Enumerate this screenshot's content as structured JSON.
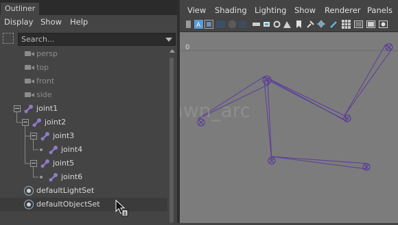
{
  "outliner": {
    "tab_label": "Outliner",
    "menu": [
      "Display",
      "Show",
      "Help"
    ],
    "search": {
      "placeholder": "Search..."
    },
    "items": [
      {
        "label": "persp",
        "type": "camera"
      },
      {
        "label": "top",
        "type": "camera"
      },
      {
        "label": "front",
        "type": "camera"
      },
      {
        "label": "side",
        "type": "camera"
      },
      {
        "label": "joint1",
        "type": "joint"
      },
      {
        "label": "joint2",
        "type": "joint"
      },
      {
        "label": "joint3",
        "type": "joint"
      },
      {
        "label": "joint4",
        "type": "joint"
      },
      {
        "label": "joint5",
        "type": "joint"
      },
      {
        "label": "joint6",
        "type": "joint"
      },
      {
        "label": "defaultLightSet",
        "type": "set"
      },
      {
        "label": "defaultObjectSet",
        "type": "set",
        "selected": true
      }
    ]
  },
  "viewport": {
    "menu": [
      "View",
      "Shading",
      "Lighting",
      "Show",
      "Renderer",
      "Panels"
    ],
    "ruler_label": "0",
    "watermark": "@dawn_arc",
    "toolbar_icons": [
      "camera-select-icon",
      "image-plane-icon",
      "film-gate-icon",
      "resolution-gate-icon",
      "gate-mask-icon",
      "field-chart-icon",
      "safe-action-icon",
      "bookmark-icon",
      "camera-attributes-icon",
      "pin-icon",
      "isolate-icon",
      "xray-icon",
      "wireframe-icon",
      "smooth-shade-icon",
      "textured-icon",
      "lit-icon"
    ]
  },
  "colors": {
    "joint": "#5a3d9a",
    "joint_icon": "#8e7cc3",
    "viewport_bg": "#7c7c7c",
    "panel_bg": "#444444"
  }
}
